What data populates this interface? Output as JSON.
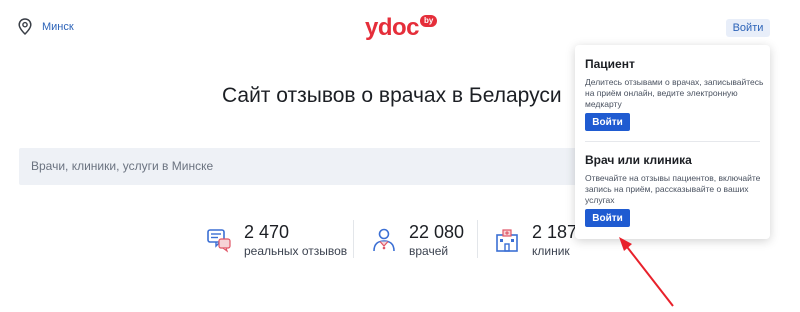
{
  "header": {
    "city": "Минск",
    "logo_text": "ydoc",
    "logo_badge": "by",
    "login_label": "Войти",
    "location_icon": "location-pin-icon"
  },
  "hero": {
    "title": "Сайт отзывов о врачах в Беларуси",
    "search_placeholder": "Врачи, клиники, услуги в Минске"
  },
  "stats": [
    {
      "number": "2 470",
      "label": "реальных отзывов",
      "icon": "reviews-icon"
    },
    {
      "number": "22 080",
      "label": "врачей",
      "icon": "doctor-icon"
    },
    {
      "number": "2 187",
      "label": "клиник",
      "icon": "clinic-icon"
    }
  ],
  "dropdown": {
    "patient": {
      "title": "Пациент",
      "description": "Делитесь отзывами о врачах, записывайтесь на приём онлайн, ведите электронную медкарту",
      "button": "Войти"
    },
    "doctor": {
      "title": "Врач или клиника",
      "description": "Отвечайте на отзывы пациентов, включайте запись на приём, рассказывайте о ваших услугах",
      "button": "Войти"
    }
  },
  "colors": {
    "brand": "#e52e3a",
    "link": "#2c63b8",
    "button": "#1f5bd1",
    "annotation_arrow": "#e8212b"
  }
}
